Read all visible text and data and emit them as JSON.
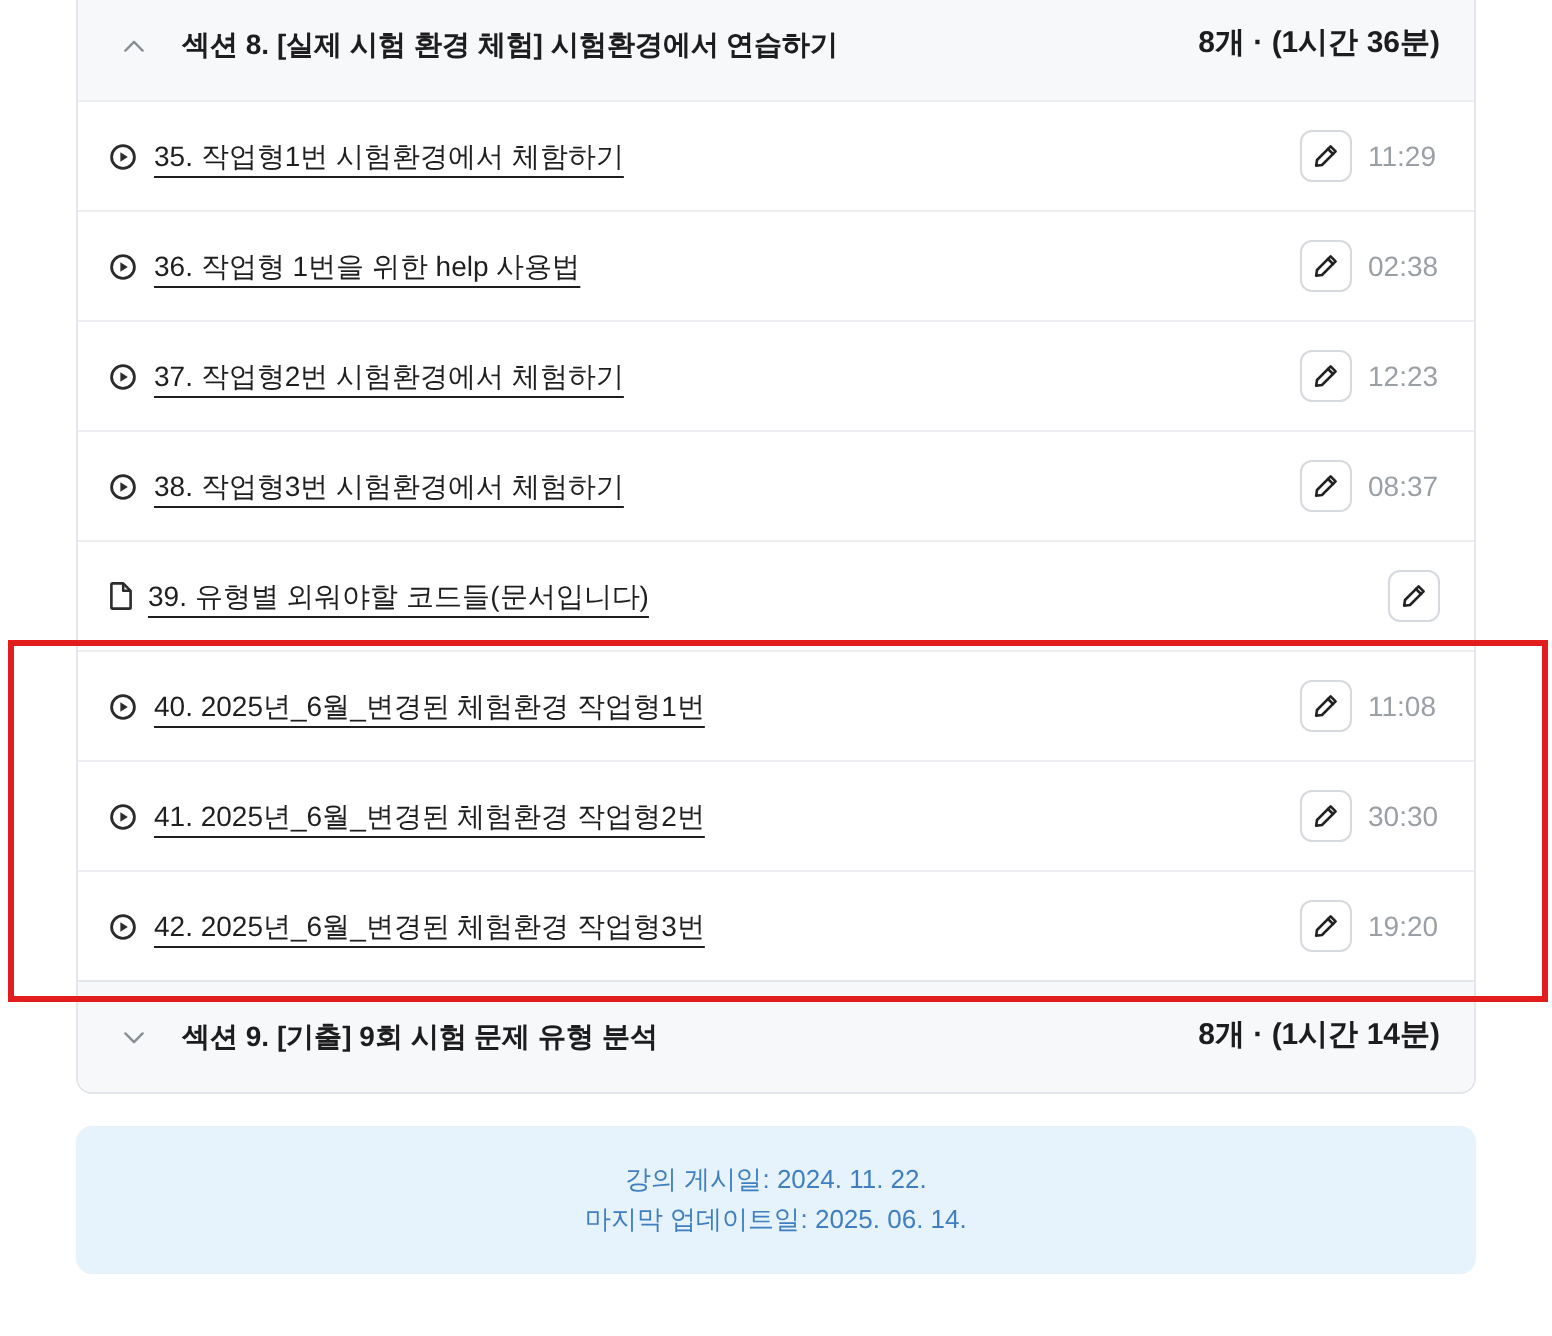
{
  "sections": [
    {
      "title": "섹션 8. [실제 시험 환경 체험] 시험환경에서 연습하기",
      "summary": "8개 · (1시간 36분)",
      "expanded": true,
      "lessons": [
        {
          "kind": "video",
          "title": "35. 작업형1번 시험환경에서 체함하기",
          "duration": "11:29",
          "highlighted": false
        },
        {
          "kind": "video",
          "title": "36. 작업형 1번을 위한 help 사용법",
          "duration": "02:38",
          "highlighted": false
        },
        {
          "kind": "video",
          "title": "37. 작업형2번 시험환경에서 체험하기",
          "duration": "12:23",
          "highlighted": false
        },
        {
          "kind": "video",
          "title": "38. 작업형3번 시험환경에서 체험하기",
          "duration": "08:37",
          "highlighted": false
        },
        {
          "kind": "document",
          "title": "39. 유형별 외워야할 코드들(문서입니다)",
          "highlighted": false
        },
        {
          "kind": "video",
          "title": "40. 2025년_6월_변경된 체험환경 작업형1번",
          "duration": "11:08",
          "highlighted": true
        },
        {
          "kind": "video",
          "title": "41. 2025년_6월_변경된 체험환경 작업형2번",
          "duration": "30:30",
          "highlighted": true
        },
        {
          "kind": "video",
          "title": "42. 2025년_6월_변경된 체험환경 작업형3번",
          "duration": "19:20",
          "highlighted": true
        }
      ]
    },
    {
      "title": "섹션 9. [기출] 9회 시험 문제 유형 분석",
      "summary": "8개 · (1시간 14분)",
      "expanded": false
    }
  ],
  "info": {
    "lines": [
      "강의 게시일: 2024. 11. 22.",
      "마지막 업데이트일: 2025. 06. 14."
    ]
  }
}
